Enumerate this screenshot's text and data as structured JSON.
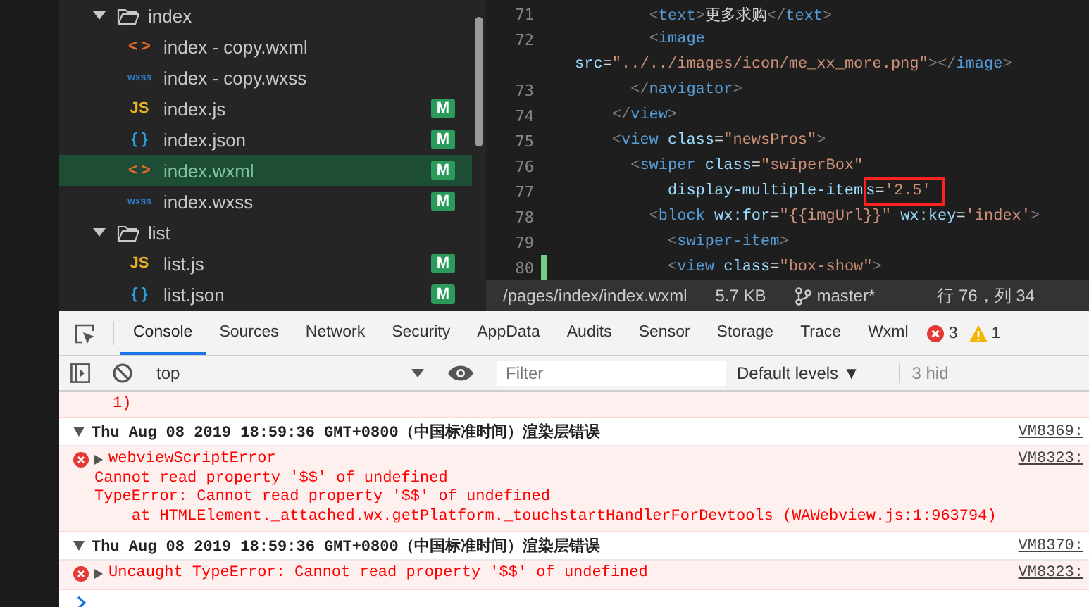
{
  "file_tree": {
    "items": [
      {
        "label": "index",
        "expanded": true,
        "children": [
          {
            "label": "index - copy.wxml",
            "kind": "wxml",
            "icon": "< >",
            "selected": false
          },
          {
            "label": "index - copy.wxss",
            "kind": "wxss",
            "icon": "wxss",
            "selected": false
          },
          {
            "label": "index.js",
            "kind": "js",
            "icon": "JS",
            "badge": "M",
            "selected": false
          },
          {
            "label": "index.json",
            "kind": "json",
            "icon": "{ }",
            "badge": "M",
            "selected": false
          },
          {
            "label": "index.wxml",
            "kind": "wxml",
            "icon": "< >",
            "badge": "M",
            "selected": true
          },
          {
            "label": "index.wxss",
            "kind": "wxss",
            "icon": "wxss",
            "badge": "M",
            "selected": false
          }
        ]
      },
      {
        "label": "list",
        "expanded": true,
        "children": [
          {
            "label": "list.js",
            "kind": "js",
            "icon": "JS",
            "badge": "M",
            "selected": false
          },
          {
            "label": "list.json",
            "kind": "json",
            "icon": "{ }",
            "badge": "M",
            "selected": false
          }
        ]
      }
    ]
  },
  "editor": {
    "lines": [
      {
        "number": "71",
        "modified": false,
        "tokens": [
          {
            "kind": "punct",
            "text": "<"
          },
          {
            "kind": "tag",
            "text": "text"
          },
          {
            "kind": "punct",
            "text": ">"
          },
          {
            "kind": "text",
            "text": "更多求购"
          },
          {
            "kind": "punct",
            "text": "</"
          },
          {
            "kind": "tag",
            "text": "text"
          },
          {
            "kind": "punct",
            "text": ">"
          }
        ]
      },
      {
        "number": "72",
        "modified": false,
        "tokens": [
          {
            "kind": "punct",
            "text": "<"
          },
          {
            "kind": "tag",
            "text": "image"
          }
        ]
      },
      {
        "modified": false,
        "tokens": [
          {
            "kind": "attr",
            "text": "src"
          },
          {
            "kind": "text",
            "text": "="
          },
          {
            "kind": "string",
            "text": "\"../../images/icon/me_xx_more.png\""
          },
          {
            "kind": "punct",
            "text": "></"
          },
          {
            "kind": "tag",
            "text": "image"
          },
          {
            "kind": "punct",
            "text": ">"
          }
        ]
      },
      {
        "number": "73",
        "modified": false,
        "tokens": [
          {
            "kind": "punct",
            "text": "</"
          },
          {
            "kind": "tag",
            "text": "navigator"
          },
          {
            "kind": "punct",
            "text": ">"
          }
        ]
      },
      {
        "number": "74",
        "modified": false,
        "tokens": [
          {
            "kind": "punct",
            "text": "</"
          },
          {
            "kind": "tag",
            "text": "view"
          },
          {
            "kind": "punct",
            "text": ">"
          }
        ]
      },
      {
        "number": "75",
        "modified": false,
        "tokens": [
          {
            "kind": "punct",
            "text": "<"
          },
          {
            "kind": "tag",
            "text": "view"
          },
          {
            "kind": "attr",
            "text": " class"
          },
          {
            "kind": "text",
            "text": "="
          },
          {
            "kind": "string",
            "text": "\"newsPros\""
          },
          {
            "kind": "punct",
            "text": ">"
          }
        ]
      },
      {
        "number": "76",
        "modified": false,
        "tokens": [
          {
            "kind": "punct",
            "text": "<"
          },
          {
            "kind": "tag",
            "text": "swiper"
          },
          {
            "kind": "attr",
            "text": " class"
          },
          {
            "kind": "text",
            "text": "="
          },
          {
            "kind": "string",
            "text": "\"swiperBox\""
          }
        ]
      },
      {
        "number": "77",
        "modified": false,
        "tokens": [
          {
            "kind": "attr",
            "text": "display-multiple-item"
          },
          {
            "kind": "attr",
            "text": "s",
            "boxed": true
          },
          {
            "kind": "text",
            "text": "=",
            "boxed": true
          },
          {
            "kind": "string",
            "text": "'2.5'",
            "boxed": true
          }
        ]
      },
      {
        "number": "78",
        "modified": false,
        "tokens": [
          {
            "kind": "punct",
            "text": "<"
          },
          {
            "kind": "tag",
            "text": "block"
          },
          {
            "kind": "attr",
            "text": " wx:for"
          },
          {
            "kind": "text",
            "text": "="
          },
          {
            "kind": "string",
            "text": "\"{{imgUrl}}\""
          },
          {
            "kind": "attr",
            "text": " wx:key"
          },
          {
            "kind": "text",
            "text": "="
          },
          {
            "kind": "string",
            "text": "'index'"
          },
          {
            "kind": "punct",
            "text": ">"
          }
        ]
      },
      {
        "number": "79",
        "modified": false,
        "tokens": [
          {
            "kind": "punct",
            "text": "<"
          },
          {
            "kind": "tag",
            "text": "swiper-item"
          },
          {
            "kind": "punct",
            "text": ">"
          }
        ]
      },
      {
        "number": "80",
        "modified": true,
        "tokens": [
          {
            "kind": "punct",
            "text": "<"
          },
          {
            "kind": "tag",
            "text": "view"
          },
          {
            "kind": "attr",
            "text": " class"
          },
          {
            "kind": "text",
            "text": "="
          },
          {
            "kind": "string",
            "text": "\"box-show\""
          },
          {
            "kind": "punct",
            "text": ">"
          }
        ]
      }
    ]
  },
  "status_bar": {
    "path": "/pages/index/index.wxml",
    "size": "5.7 KB",
    "branch": "master*",
    "position": "行 76，列 34"
  },
  "devtools": {
    "tabs": [
      {
        "label": "Console",
        "selected": true
      },
      {
        "label": "Sources",
        "selected": false
      },
      {
        "label": "Network",
        "selected": false
      },
      {
        "label": "Security",
        "selected": false
      },
      {
        "label": "AppData",
        "selected": false
      },
      {
        "label": "Audits",
        "selected": false
      },
      {
        "label": "Sensor",
        "selected": false
      },
      {
        "label": "Storage",
        "selected": false
      },
      {
        "label": "Trace",
        "selected": false
      },
      {
        "label": "Wxml",
        "selected": false
      }
    ],
    "error_count": "3",
    "warning_count": "1",
    "context": "top",
    "filter": {
      "placeholder": "Filter"
    },
    "levels": "Default levels ▼",
    "hidden": "3 hid"
  },
  "console": {
    "messages": [
      {
        "kind": "fragment",
        "lines": [
          "1)"
        ]
      },
      {
        "kind": "group",
        "text": "Thu Aug 08 2019 18:59:36 GMT+0800（中国标准时间）渲染层错误",
        "source": "VM8369:"
      },
      {
        "kind": "error",
        "title": "webviewScriptError",
        "source": "VM8323:",
        "lines": [
          "Cannot read property '$$' of undefined",
          "TypeError: Cannot read property '$$' of undefined",
          "    at HTMLElement._attached.wx.getPlatform._touchstartHandlerForDevtools (WAWebview.js:1:963794)"
        ]
      },
      {
        "kind": "group",
        "text": "Thu Aug 08 2019 18:59:36 GMT+0800（中国标准时间）渲染层错误",
        "source": "VM8370:"
      },
      {
        "kind": "error",
        "title": "Uncaught TypeError: Cannot read property '$$' of undefined",
        "source": "VM8323:"
      }
    ]
  }
}
